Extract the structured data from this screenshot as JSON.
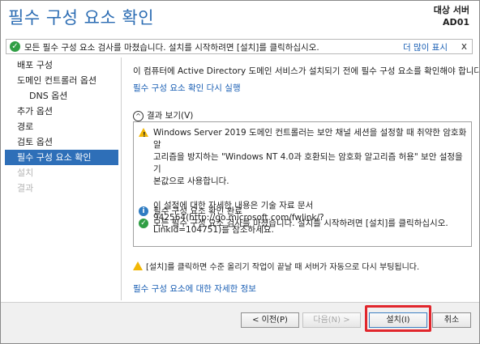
{
  "header": {
    "title": "필수 구성 요소 확인",
    "server_label": "대상 서버",
    "server_name": "AD01"
  },
  "notice": {
    "message": "모든 필수 구성 요소 검사를 마쳤습니다. 설치를 시작하려면 [설치]를 클릭하십시오.",
    "more_link": "더 많이 표시",
    "close": "x"
  },
  "sidebar": {
    "items": [
      {
        "label": "배포 구성",
        "state": "normal"
      },
      {
        "label": "도메인 컨트롤러 옵션",
        "state": "normal"
      },
      {
        "label": "DNS 옵션",
        "state": "sub"
      },
      {
        "label": "추가 옵션",
        "state": "normal"
      },
      {
        "label": "경로",
        "state": "normal"
      },
      {
        "label": "검토 옵션",
        "state": "normal"
      },
      {
        "label": "필수 구성 요소 확인",
        "state": "active"
      },
      {
        "label": "설치",
        "state": "disabled"
      },
      {
        "label": "결과",
        "state": "disabled"
      }
    ]
  },
  "main": {
    "intro": "이 컴퓨터에 Active Directory 도메인 서비스가 설치되기 전에 필수 구성 요소를 확인해야 합니다.",
    "rerun_link": "필수 구성 요소 확인 다시 실행",
    "results_toggle": "결과 보기(V)",
    "results": [
      {
        "icon": "warning-icon",
        "lines": [
          "Windows Server 2019 도메인 컨트롤러는 보안 채널 세션을 설정할 때 취약한 암호화 알",
          "고리즘을 방지하는 \"Windows NT 4.0과 호환되는 암호화 알고리즘 허용\" 보안 설정을 기",
          "본값으로 사용합니다.",
          "",
          "이 설정에 대한 자세한 내용은 기술 자료 문서 942564(http://go.microsoft.com/fwlink/?",
          "LinkId=104751)를 참조하세요."
        ]
      },
      {
        "icon": "info-icon",
        "lines": [
          "필수 구성 요소 확인 완료"
        ]
      },
      {
        "icon": "success-icon",
        "lines": [
          "모든 필수 구성 요소 검사를 마쳤습니다. 설치를 시작하려면 [설치]를 클릭하십시오."
        ]
      }
    ],
    "footer_warning": "[설치]를 클릭하면 수준 올리기 작업이 끝날 때 서버가 자동으로 다시 부팅됩니다.",
    "more_info_link": "필수 구성 요소에 대한 자세한 정보"
  },
  "buttons": {
    "previous": "< 이전(P)",
    "next": "다음(N) >",
    "install": "설치(I)",
    "cancel": "취소"
  },
  "colors": {
    "title_blue": "#2b6cb3",
    "nav_active": "#2e6fb8",
    "link_blue": "#1a5fb4",
    "highlight_red": "#e1262c",
    "warning_yellow": "#f2b705",
    "success_green": "#2f9e44"
  }
}
